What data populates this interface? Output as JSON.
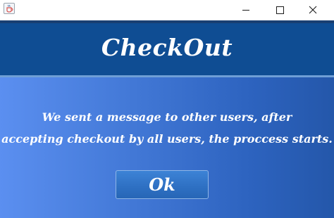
{
  "titlebar": {
    "app_icon": "java-coffee-cup-icon",
    "controls": [
      "minimize-icon",
      "maximize-icon",
      "close-icon"
    ]
  },
  "dialog": {
    "heading": "CheckOut",
    "message_line_1": "We sent a message to other users, after",
    "message_line_2": "accepting checkout by all users, the proccess starts.",
    "ok_label": "Ok"
  },
  "colors": {
    "header_band": "#0f4d93",
    "panel_gradient_start": "#5b8ff0",
    "panel_gradient_end": "#2457aa",
    "button": "#2f71c4",
    "text": "#ffffff"
  }
}
